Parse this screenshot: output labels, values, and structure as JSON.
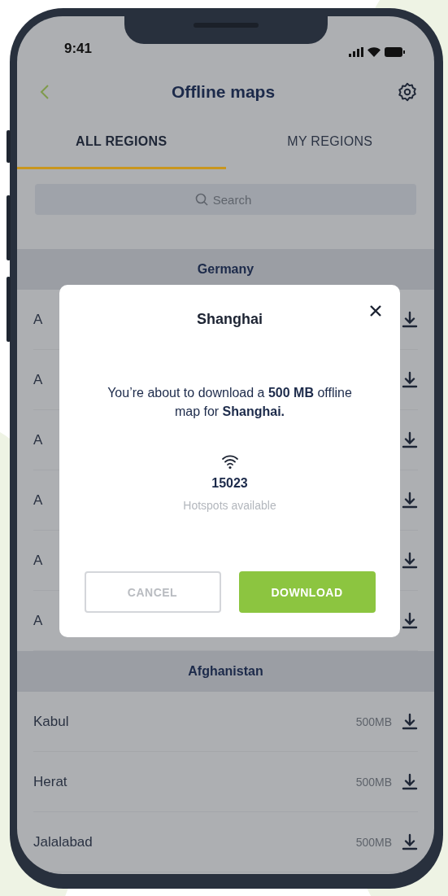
{
  "status_bar": {
    "time": "9:41"
  },
  "header": {
    "title": "Offline maps"
  },
  "tabs": [
    {
      "label": "ALL REGIONS",
      "selected": true
    },
    {
      "label": "MY REGIONS",
      "selected": false
    }
  ],
  "search": {
    "placeholder": "Search"
  },
  "sections": [
    {
      "title": "Germany",
      "rows": [
        {
          "name": "A"
        },
        {
          "name": "A"
        },
        {
          "name": "A"
        },
        {
          "name": "A"
        },
        {
          "name": "A"
        },
        {
          "name": "A"
        }
      ]
    },
    {
      "title": "Afghanistan",
      "rows": [
        {
          "name": "Kabul",
          "size": "500MB"
        },
        {
          "name": "Herat",
          "size": "500MB"
        },
        {
          "name": "Jalalabad",
          "size": "500MB"
        }
      ]
    }
  ],
  "modal": {
    "title": "Shanghai",
    "message": "You’re about to download a **500 MB** offline map for **Shanghai.**",
    "hotspot_count": "15023",
    "hotspot_label": "Hotspots available",
    "buttons": [
      {
        "label": "CANCEL",
        "kind": "secondary"
      },
      {
        "label": "DOWNLOAD",
        "kind": "primary"
      }
    ]
  }
}
